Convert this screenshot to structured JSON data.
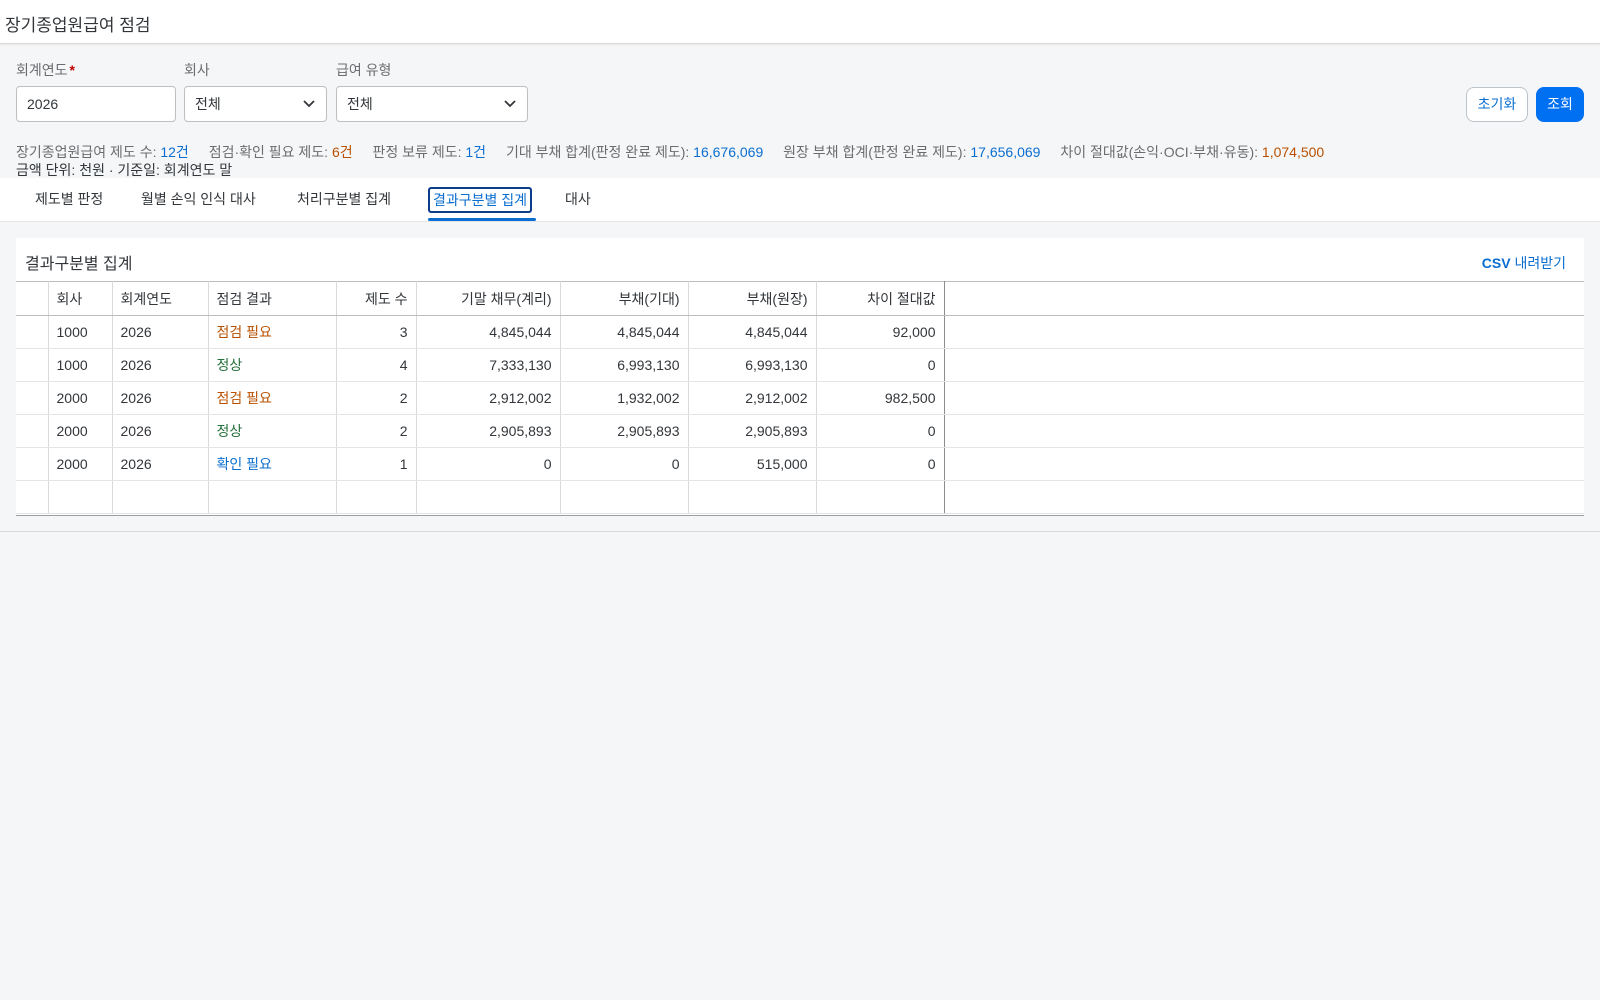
{
  "page": {
    "title": "장기종업원급여 점검"
  },
  "filters": {
    "year": {
      "label": "회계연도",
      "required_mark": "*",
      "value": "2026"
    },
    "company": {
      "label": "회사",
      "value": "전체"
    },
    "pay_type": {
      "label": "급여 유형",
      "value": "전체"
    }
  },
  "buttons": {
    "reset": "초기화",
    "search": "조회"
  },
  "summary": {
    "plans_label": "장기종업원급여 제도 수:",
    "plans_value": "12건",
    "check_label": "점검·확인 필요 제도:",
    "check_value": "6건",
    "hold_label": "판정 보류 제도:",
    "hold_value": "1건",
    "expected_label": "기대 부채 합계(판정 완료 제도):",
    "expected_value": "16,676,069",
    "ledger_label": "원장 부채 합계(판정 완료 제도):",
    "ledger_value": "17,656,069",
    "diff_label": "차이 절대값(손익·OCI·부채·유동):",
    "diff_value": "1,074,500",
    "unit_line": "금액 단위: 천원 · 기준일: 회계연도 말"
  },
  "tabs": [
    "제도별 판정",
    "월별 손익 인식 대사",
    "처리구분별 집계",
    "결과구분별 집계",
    "대사"
  ],
  "active_tab": "결과구분별 집계",
  "panel": {
    "title": "결과구분별 집계",
    "csv_prefix": "CSV",
    "csv_suffix": "내려받기"
  },
  "table": {
    "columns": [
      "회사",
      "회계연도",
      "점검 결과",
      "제도 수",
      "기말 채무(계리)",
      "부채(기대)",
      "부채(원장)",
      "차이 절대값"
    ],
    "rows": [
      {
        "company": "1000",
        "year": "2026",
        "result": "점검 필요",
        "status": "orange",
        "count": "3",
        "obligation": "4,845,044",
        "liab_expected": "4,845,044",
        "liab_ledger": "4,845,044",
        "diff": "92,000"
      },
      {
        "company": "1000",
        "year": "2026",
        "result": "정상",
        "status": "green",
        "count": "4",
        "obligation": "7,333,130",
        "liab_expected": "6,993,130",
        "liab_ledger": "6,993,130",
        "diff": "0"
      },
      {
        "company": "2000",
        "year": "2026",
        "result": "점검 필요",
        "status": "orange",
        "count": "2",
        "obligation": "2,912,002",
        "liab_expected": "1,932,002",
        "liab_ledger": "2,912,002",
        "diff": "982,500"
      },
      {
        "company": "2000",
        "year": "2026",
        "result": "정상",
        "status": "green",
        "count": "2",
        "obligation": "2,905,893",
        "liab_expected": "2,905,893",
        "liab_ledger": "2,905,893",
        "diff": "0"
      },
      {
        "company": "2000",
        "year": "2026",
        "result": "확인 필요",
        "status": "blue",
        "count": "1",
        "obligation": "0",
        "liab_expected": "0",
        "liab_ledger": "515,000",
        "diff": "0"
      }
    ]
  },
  "colors": {
    "primary": "#0070f2",
    "link": "#0a6ed1",
    "warning": "#b95000",
    "success": "#256f3a",
    "required": "#bb0000"
  }
}
